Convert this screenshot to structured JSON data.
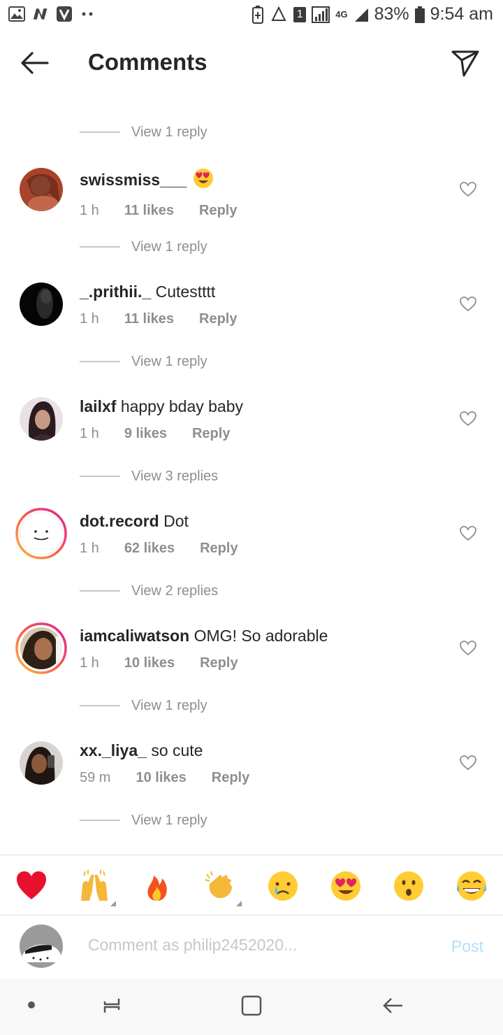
{
  "status_bar": {
    "battery": "83%",
    "time": "9:54 am",
    "network": "4G",
    "sim": "1",
    "left_icons": [
      "gallery-icon",
      "n-app-icon",
      "v-app-icon",
      "more-dots-icon"
    ]
  },
  "header": {
    "title": "Comments",
    "back_icon": "arrow-left-icon",
    "share_icon": "paper-plane-icon"
  },
  "view_replies": [
    "View 1 reply",
    "View 1 reply",
    "View 1 reply",
    "View 3 replies",
    "View 2 replies",
    "View 1 reply",
    "View 1 reply"
  ],
  "comments": [
    {
      "username": "swissmiss___",
      "text": "",
      "emoji": "heart-eyes-emoji",
      "time": "1 h",
      "likes": "11 likes",
      "reply": "Reply"
    },
    {
      "username": "_.prithii._",
      "text": "Cutestttt",
      "time": "1 h",
      "likes": "11 likes",
      "reply": "Reply"
    },
    {
      "username": "lailxf",
      "text": "happy bday baby",
      "time": "1 h",
      "likes": "9 likes",
      "reply": "Reply"
    },
    {
      "username": "dot.record",
      "text": "Dot",
      "time": "1 h",
      "likes": "62 likes",
      "reply": "Reply"
    },
    {
      "username": "iamcaliwatson",
      "text": "OMG! So adorable",
      "time": "1 h",
      "likes": "10 likes",
      "reply": "Reply"
    },
    {
      "username": "xx._liya_",
      "text": "so cute",
      "time": "59 m",
      "likes": "10 likes",
      "reply": "Reply"
    }
  ],
  "emoji_bar": [
    "red-heart",
    "raising-hands",
    "fire",
    "clapping-hands",
    "crying-face",
    "heart-eyes",
    "surprised-face",
    "tears-of-joy"
  ],
  "composer": {
    "placeholder": "Comment as philip2452020...",
    "post_label": "Post"
  },
  "colors": {
    "text": "#262626",
    "muted": "#8e8e8e",
    "post": "#b2dffc",
    "story_ring_start": "#d6249f",
    "story_ring_end": "#fd9c3f"
  }
}
